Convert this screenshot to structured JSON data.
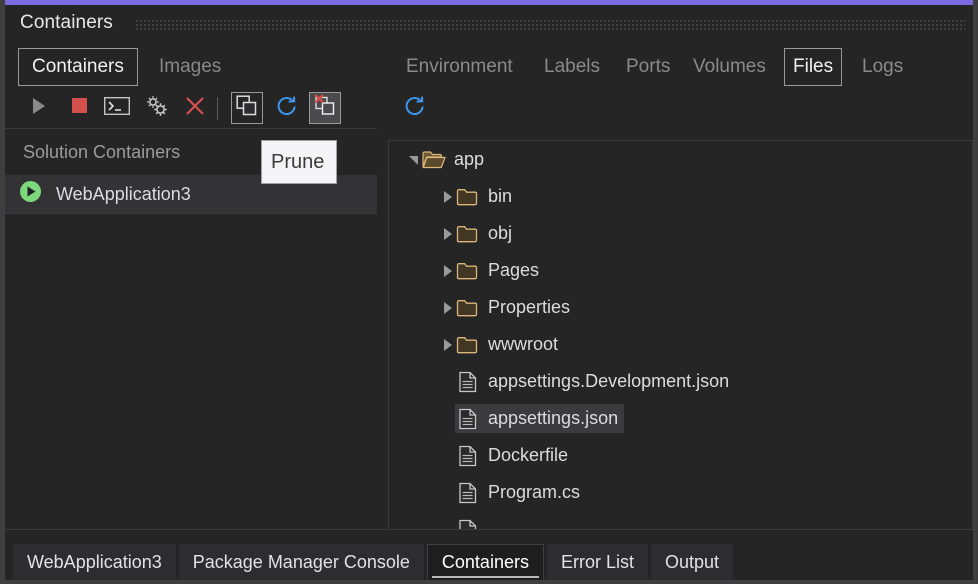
{
  "window": {
    "panel_title": "Containers",
    "accent_color": "#7a6ce0"
  },
  "left_panel": {
    "tabs": [
      {
        "label": "Containers",
        "active": true
      },
      {
        "label": "Images",
        "active": false
      }
    ],
    "toolbar": [
      {
        "name": "start-button",
        "icon": "play-icon"
      },
      {
        "name": "stop-button",
        "icon": "stop-square-icon"
      },
      {
        "name": "terminal-button",
        "icon": "terminal-icon"
      },
      {
        "name": "settings-button",
        "icon": "gears-icon"
      },
      {
        "name": "remove-button",
        "icon": "close-x-icon"
      },
      {
        "name": "view-containers-button",
        "icon": "stack-icon"
      },
      {
        "name": "refresh-button",
        "icon": "refresh-icon"
      },
      {
        "name": "prune-button",
        "icon": "prune-stack-x-icon"
      }
    ],
    "section_header": "Solution Containers",
    "containers": [
      {
        "name": "WebApplication3",
        "status": "running",
        "selected": true
      }
    ]
  },
  "tooltip": {
    "label": "Prune"
  },
  "right_panel": {
    "tabs": [
      {
        "label": "Environment",
        "active": false
      },
      {
        "label": "Labels",
        "active": false
      },
      {
        "label": "Ports",
        "active": false
      },
      {
        "label": "Volumes",
        "active": false
      },
      {
        "label": "Files",
        "active": true
      },
      {
        "label": "Logs",
        "active": false
      }
    ],
    "toolbar": [
      {
        "name": "files-refresh-button",
        "icon": "refresh-icon"
      }
    ],
    "file_tree": [
      {
        "label": "app",
        "type": "folder-open",
        "depth": 0,
        "expanded": true,
        "selected": false
      },
      {
        "label": "bin",
        "type": "folder",
        "depth": 1,
        "expanded": false,
        "selected": false
      },
      {
        "label": "obj",
        "type": "folder",
        "depth": 1,
        "expanded": false,
        "selected": false
      },
      {
        "label": "Pages",
        "type": "folder",
        "depth": 1,
        "expanded": false,
        "selected": false
      },
      {
        "label": "Properties",
        "type": "folder",
        "depth": 1,
        "expanded": false,
        "selected": false
      },
      {
        "label": "wwwroot",
        "type": "folder",
        "depth": 1,
        "expanded": false,
        "selected": false
      },
      {
        "label": "appsettings.Development.json",
        "type": "file",
        "depth": 1,
        "expanded": false,
        "selected": false
      },
      {
        "label": "appsettings.json",
        "type": "file",
        "depth": 1,
        "expanded": false,
        "selected": true
      },
      {
        "label": "Dockerfile",
        "type": "file",
        "depth": 1,
        "expanded": false,
        "selected": false
      },
      {
        "label": "Program.cs",
        "type": "file",
        "depth": 1,
        "expanded": false,
        "selected": false
      },
      {
        "label": "",
        "type": "file",
        "depth": 1,
        "expanded": false,
        "selected": false
      }
    ]
  },
  "bottom_tabs": [
    {
      "label": "WebApplication3",
      "active": false
    },
    {
      "label": "Package Manager Console",
      "active": false
    },
    {
      "label": "Containers",
      "active": true
    },
    {
      "label": "Error List",
      "active": false
    },
    {
      "label": "Output",
      "active": false
    }
  ],
  "colors": {
    "accent": "#7a6ce0",
    "background": "#252526",
    "selection": "#3b3b3d",
    "refresh_blue": "#3d96e8",
    "folder_gold": "#dcb67a",
    "status_green": "#7bd87b",
    "danger_red": "#d4504c"
  }
}
